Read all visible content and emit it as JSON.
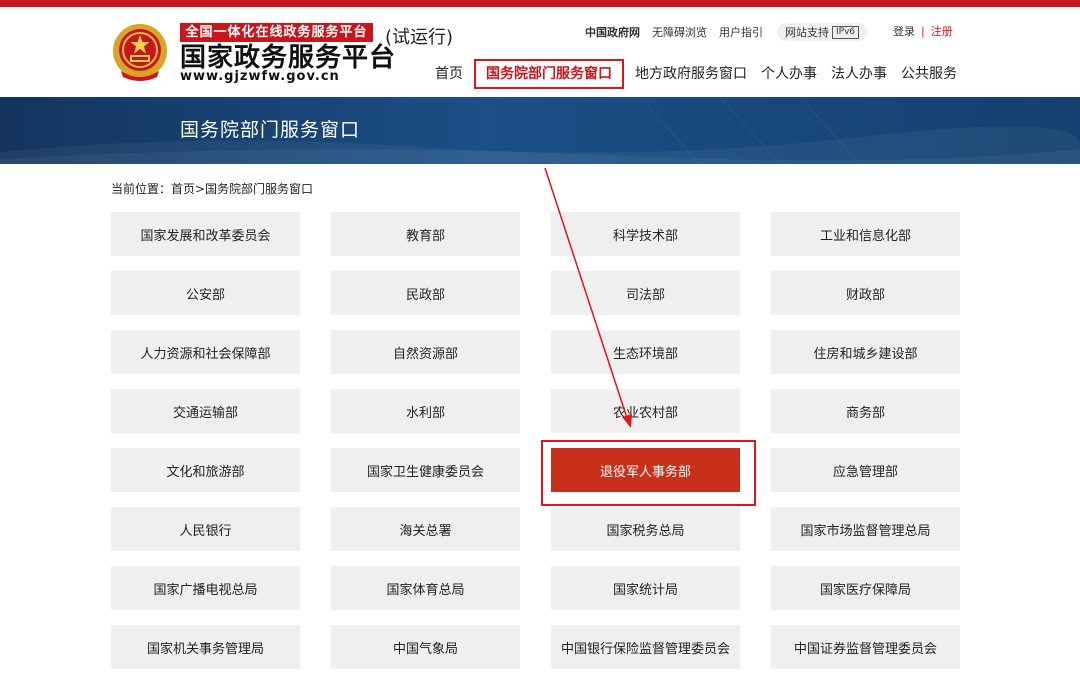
{
  "header": {
    "logo_badge": "全国一体化在线政务服务平台",
    "logo_title": "国家政务服务平台",
    "logo_url": "www.gjzwfw.gov.cn",
    "trial": "(试运行)",
    "util_links": [
      "中国政府网",
      "无障碍浏览",
      "用户指引"
    ],
    "site_support": "网站支持",
    "ipv6": "IPv6",
    "login": "登录",
    "register": "注册",
    "nav": [
      "首页",
      "国务院部门服务窗口",
      "地方政府服务窗口",
      "个人办事",
      "法人办事",
      "公共服务"
    ]
  },
  "banner": {
    "title": "国务院部门服务窗口"
  },
  "breadcrumb": {
    "text": "当前位置：首页>国务院部门服务窗口"
  },
  "departments": [
    "国家发展和改革委员会",
    "教育部",
    "科学技术部",
    "工业和信息化部",
    "公安部",
    "民政部",
    "司法部",
    "财政部",
    "人力资源和社会保障部",
    "自然资源部",
    "生态环境部",
    "住房和城乡建设部",
    "交通运输部",
    "水利部",
    "农业农村部",
    "商务部",
    "文化和旅游部",
    "国家卫生健康委员会",
    "退役军人事务部",
    "应急管理部",
    "人民银行",
    "海关总署",
    "国家税务总局",
    "国家市场监督管理总局",
    "国家广播电视总局",
    "国家体育总局",
    "国家统计局",
    "国家医疗保障局",
    "国家机关事务管理局",
    "中国气象局",
    "中国银行保险监督管理委员会",
    "中国证券监督管理委员会"
  ],
  "colors": {
    "brand_red": "#c8161d",
    "highlight_tile": "#c8301c",
    "banner_blue": "#1b4f86",
    "tile_gray": "#efefef"
  }
}
